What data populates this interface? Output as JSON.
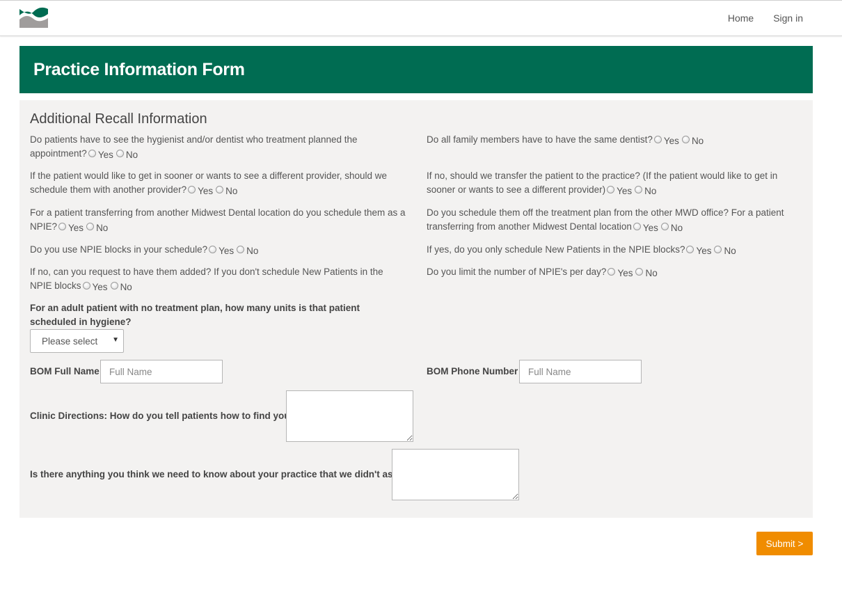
{
  "nav": {
    "home": "Home",
    "sign_in": "Sign in"
  },
  "colors": {
    "brand_green": "#006c52",
    "submit_orange": "#f08c00",
    "logo_gray": "#a09d9c"
  },
  "header": {
    "title": "Practice Information Form"
  },
  "section": {
    "title": "Additional Recall Information"
  },
  "options": {
    "yes": "Yes",
    "no": "No"
  },
  "questions": {
    "q1": "Do patients have to see the hygienist and/or dentist who treatment planned the appointment?",
    "q2": "Do all family members have to have the same dentist?",
    "q3": "If the patient would like to get in sooner or wants to see a different provider, should we schedule them with another provider?",
    "q4": "If no, should we transfer the patient to the practice? (If the patient would like to get in sooner or wants to see a different provider)",
    "q5": "For a patient transferring from another Midwest Dental location do you schedule them as a NPIE?",
    "q6": "Do you schedule them off the treatment plan from the other MWD office? For a patient transferring from another Midwest Dental location",
    "q7": "Do you use NPIE blocks in your schedule?",
    "q8": "If yes, do you only schedule New Patients in the NPIE blocks?",
    "q9": "If no, can you request to have them added? If you don't schedule New Patients in the NPIE blocks",
    "q10": "Do you limit the number of NPIE's per day?"
  },
  "units_question": "For an adult patient with no treatment plan, how many units is that patient scheduled in hygiene?",
  "units_select": {
    "value": "Please select"
  },
  "bom": {
    "name_label": "BOM Full Name",
    "name_placeholder": "Full Name",
    "phone_label": "BOM Phone Number",
    "phone_placeholder": "Full Name"
  },
  "directions_label": "Clinic Directions: How do you tell patients how to find you?",
  "anything_label": "Is there anything you think we need to know about your practice that we didn't ask?",
  "submit_label": "Submit >"
}
